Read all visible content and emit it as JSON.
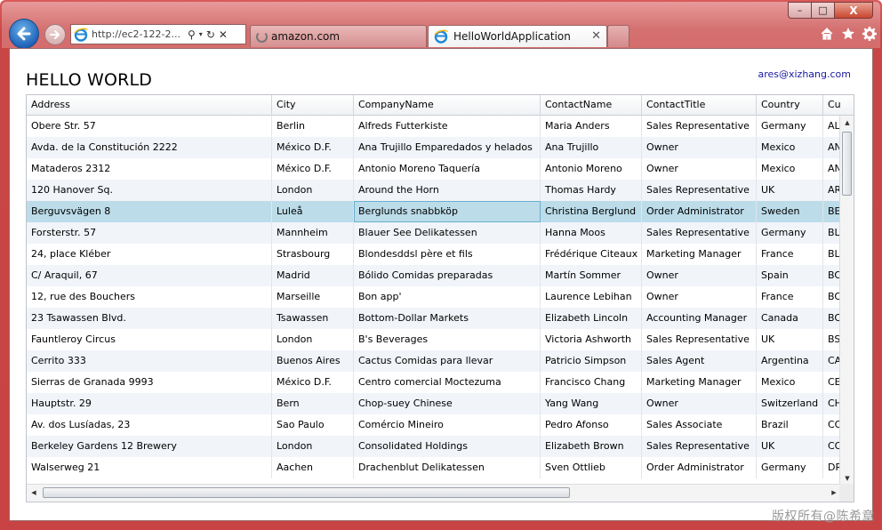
{
  "browser": {
    "url": "http://ec2-122-2...",
    "tabs": [
      {
        "label": "amazon.com"
      },
      {
        "label": "HelloWorldApplication"
      }
    ],
    "icons": [
      "back-arrow-icon",
      "forward-arrow-icon",
      "ie-logo-icon",
      "search-icon",
      "dropdown-icon",
      "refresh-icon",
      "stop-icon",
      "home-icon",
      "favorites-star-icon",
      "gear-icon"
    ],
    "caption": {
      "minimize": "–",
      "maximize": "□",
      "close": "X"
    }
  },
  "page": {
    "title": "HELLO WORLD",
    "user": "ares@xizhang.com"
  },
  "grid": {
    "columns": [
      "Address",
      "City",
      "CompanyName",
      "ContactName",
      "ContactTitle",
      "Country",
      "Cu"
    ],
    "rows": [
      [
        "Obere Str. 57",
        "Berlin",
        "Alfreds Futterkiste",
        "Maria Anders",
        "Sales Representative",
        "Germany",
        "AL"
      ],
      [
        "Avda. de la Constitución 2222",
        "México D.F.",
        "Ana Trujillo Emparedados y helados",
        "Ana Trujillo",
        "Owner",
        "Mexico",
        "AN"
      ],
      [
        "Mataderos  2312",
        "México D.F.",
        "Antonio Moreno Taquería",
        "Antonio Moreno",
        "Owner",
        "Mexico",
        "AN"
      ],
      [
        "120 Hanover Sq.",
        "London",
        "Around the Horn",
        "Thomas Hardy",
        "Sales Representative",
        "UK",
        "AR"
      ],
      [
        "Berguvsvägen  8",
        "Luleå",
        "Berglunds snabbköp",
        "Christina Berglund",
        "Order Administrator",
        "Sweden",
        "BE"
      ],
      [
        "Forsterstr. 57",
        "Mannheim",
        "Blauer See Delikatessen",
        "Hanna Moos",
        "Sales Representative",
        "Germany",
        "BL"
      ],
      [
        "24, place Kléber",
        "Strasbourg",
        "Blondesddsl père et fils",
        "Frédérique Citeaux",
        "Marketing Manager",
        "France",
        "BL"
      ],
      [
        "C/ Araquil, 67",
        "Madrid",
        "Bólido Comidas preparadas",
        "Martín Sommer",
        "Owner",
        "Spain",
        "BO"
      ],
      [
        "12, rue des Bouchers",
        "Marseille",
        "Bon app'",
        "Laurence Lebihan",
        "Owner",
        "France",
        "BO"
      ],
      [
        "23 Tsawassen Blvd.",
        "Tsawassen",
        "Bottom-Dollar Markets",
        "Elizabeth Lincoln",
        "Accounting Manager",
        "Canada",
        "BO"
      ],
      [
        "Fauntleroy Circus",
        "London",
        "B's Beverages",
        "Victoria Ashworth",
        "Sales Representative",
        "UK",
        "BS"
      ],
      [
        "Cerrito 333",
        "Buenos Aires",
        "Cactus Comidas para llevar",
        "Patricio Simpson",
        "Sales Agent",
        "Argentina",
        "CA"
      ],
      [
        "Sierras de Granada 9993",
        "México D.F.",
        "Centro comercial Moctezuma",
        "Francisco Chang",
        "Marketing Manager",
        "Mexico",
        "CE"
      ],
      [
        "Hauptstr. 29",
        "Bern",
        "Chop-suey Chinese",
        "Yang Wang",
        "Owner",
        "Switzerland",
        "CH"
      ],
      [
        "Av. dos Lusíadas, 23",
        "Sao Paulo",
        "Comércio Mineiro",
        "Pedro Afonso",
        "Sales Associate",
        "Brazil",
        "CO"
      ],
      [
        "Berkeley Gardens 12  Brewery",
        "London",
        "Consolidated Holdings",
        "Elizabeth Brown",
        "Sales Representative",
        "UK",
        "CO"
      ],
      [
        "Walserweg 21",
        "Aachen",
        "Drachenblut Delikatessen",
        "Sven Ottlieb",
        "Order Administrator",
        "Germany",
        "DR"
      ]
    ],
    "selected_row": 4
  },
  "watermark": "版权所有@陈希章"
}
